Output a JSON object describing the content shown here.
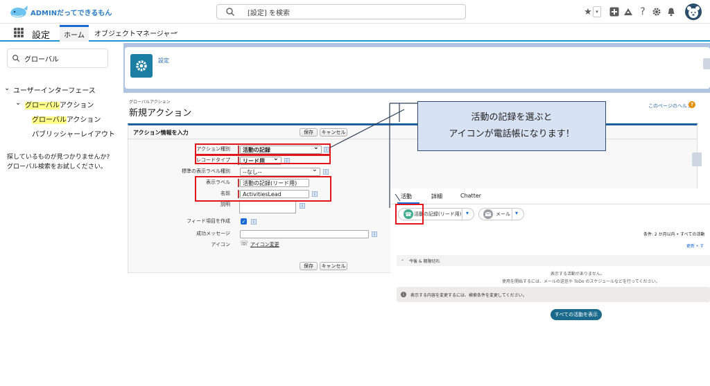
{
  "header": {
    "logo_text": "ADMINだってできるもん",
    "search_placeholder": "[設定] を検索"
  },
  "nav": {
    "app_name": "設定",
    "tabs": [
      {
        "label": "ホーム"
      },
      {
        "label": "オブジェクトマネージャー"
      }
    ]
  },
  "sidebar": {
    "quickfind_value": "グローバル",
    "tree": {
      "section": "ユーザーインターフェース",
      "group_hl": "グローバル",
      "group_rest": "アクション",
      "item1_hl": "グローバル",
      "item1_rest": "アクション",
      "item2": "パブリッシャーレイアウト"
    },
    "nomatch_line1": "探しているものが見つかりませんか?",
    "nomatch_line2": "グローバル検索をお試しください。"
  },
  "setup_header": {
    "link": "設定"
  },
  "page": {
    "breadcrumb": "グローバルアクション",
    "title": "新規アクション",
    "help_link": "このページのヘルプ"
  },
  "form": {
    "heading": "アクション情報を入力",
    "save": "保存",
    "cancel": "キャンセル",
    "fields": {
      "action_type_label": "アクション種別",
      "action_type_value": "活動の記録",
      "record_type_label": "レコードタイプ",
      "record_type_value": "リード用",
      "std_label_type_label": "標準の表示ラベル種別",
      "std_label_type_value": "--なし--",
      "label_label": "表示ラベル",
      "label_value": "活動の記録(リード用)",
      "name_label": "名前",
      "name_value": "ActivitiesLead",
      "desc_label": "説明",
      "feed_label": "フィード項目を作成",
      "success_msg_label": "成功メッセージ",
      "icon_label": "アイコン",
      "icon_change": "アイコン変更"
    }
  },
  "callout": {
    "line1": "活動の記録を選ぶと",
    "line2": "アイコンが電話帳になります！"
  },
  "activity": {
    "tabs": [
      "活動",
      "詳細",
      "Chatter"
    ],
    "log_button": "活動の記録(リード用)",
    "mail_button": "メール",
    "filter_text": "条件: 2 か月以内 • すべての活動",
    "refresh_text": "更新 • す",
    "section": "今後 & 期限切れ",
    "empty_line1": "表示する活動がありません。",
    "empty_line2": "使用を開始するには、メールの送信や ToDo のスケジュールなどを行ってください。",
    "banner": "表示する内容を変更するには、検索条件を変更してください。",
    "show_all": "すべての活動を表示"
  },
  "colors": {
    "brand_blue": "#1b96d4",
    "red_highlight": "#e2141a",
    "callout_fill": "#d7e3f3",
    "gear_tile": "#1a7ea3"
  }
}
